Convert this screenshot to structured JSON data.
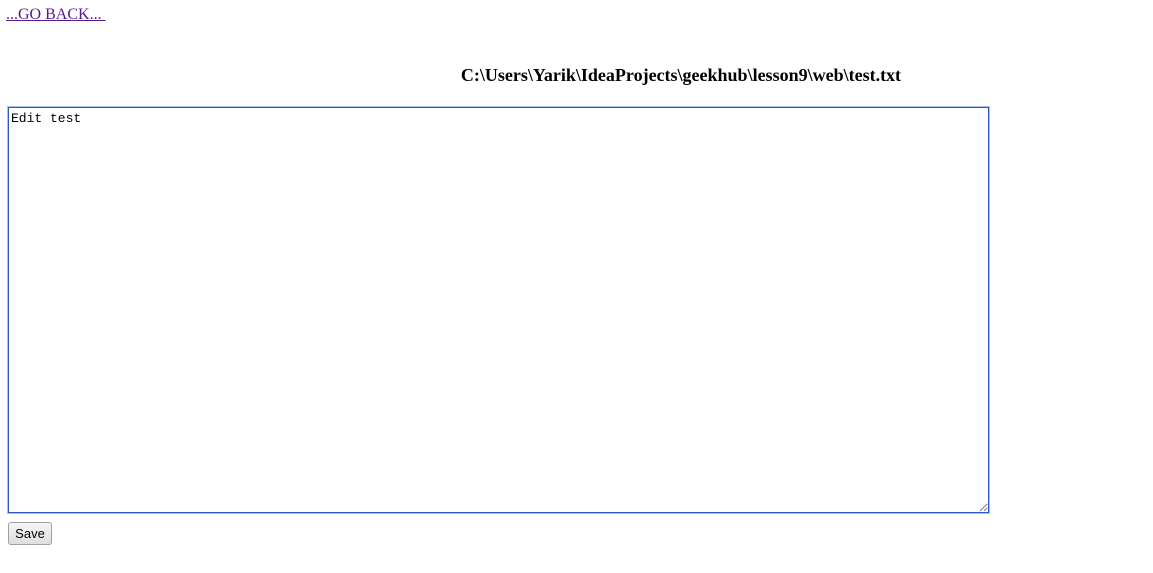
{
  "nav": {
    "back_label": "...GO BACK... "
  },
  "file": {
    "path": "C:\\Users\\Yarik\\IdeaProjects\\geekhub\\lesson9\\web\\test.txt"
  },
  "editor": {
    "content": "Edit test"
  },
  "actions": {
    "save_label": "Save"
  },
  "colors": {
    "link_visited": "#551a8b",
    "editor_focus_border": "#2a56c6"
  }
}
